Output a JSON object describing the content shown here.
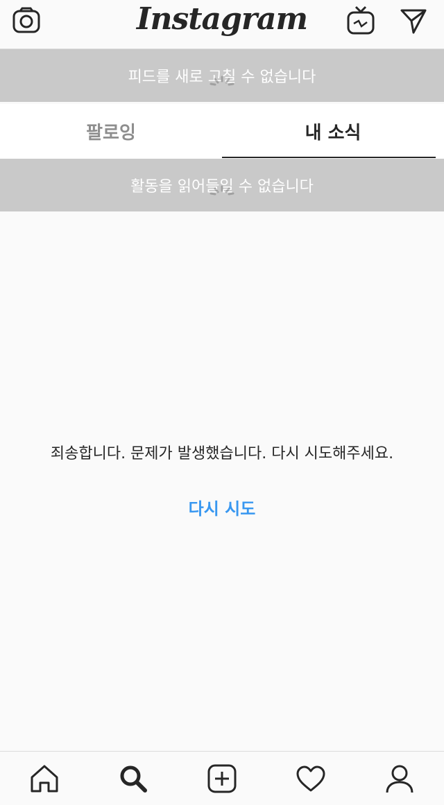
{
  "header": {
    "logo_text": "Instagram",
    "icons": [
      "camera-icon",
      "igtv-icon",
      "direct-message-icon"
    ]
  },
  "feed_banner": {
    "text": "피드를 새로 고칠 수 없습니다"
  },
  "tabs": [
    {
      "label": "팔로잉",
      "active": false
    },
    {
      "label": "내 소식",
      "active": true
    }
  ],
  "activity_banner": {
    "text": "활동을 읽어들일 수 없습니다"
  },
  "error": {
    "message": "죄송합니다. 문제가 발생했습니다. 다시 시도해주세요.",
    "retry_label": "다시 시도"
  },
  "bottom_nav": {
    "items": [
      "home-icon",
      "search-icon",
      "add-post-icon",
      "activity-heart-icon",
      "profile-icon"
    ]
  },
  "colors": {
    "accent": "#3897f0",
    "banner_bg": "#c9c9c9",
    "text_primary": "#262626",
    "text_secondary": "#8e8e8e"
  }
}
